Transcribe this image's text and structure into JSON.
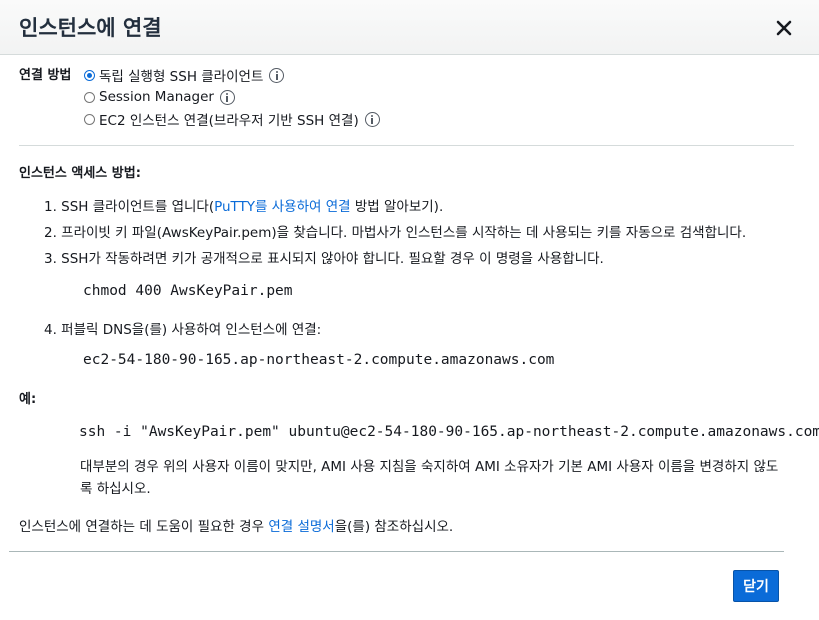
{
  "modal": {
    "title": "인스턴스에 연결"
  },
  "connection_method": {
    "label": "연결 방법",
    "options": [
      {
        "label": "독립 실행형 SSH 클라이언트",
        "selected": true
      },
      {
        "label": "Session Manager",
        "selected": false
      },
      {
        "label": "EC2 인스턴스 연결(브라우저 기반 SSH 연결)",
        "selected": false
      }
    ]
  },
  "access": {
    "title": "인스턴스 액세스 방법:",
    "step1": {
      "prefix": "1. SSH 클라이언트를 엽니다(",
      "link": "PuTTY를 사용하여 연결",
      "suffix": " 방법 알아보기)."
    },
    "step2": "2. 프라이빗 키 파일(AwsKeyPair.pem)을 찾습니다. 마법사가 인스턴스를 시작하는 데 사용되는 키를 자동으로 검색합니다.",
    "step3": "3. SSH가 작동하려면 키가 공개적으로 표시되지 않아야 합니다. 필요할 경우 이 명령을 사용합니다.",
    "chmod_cmd": "chmod 400 AwsKeyPair.pem",
    "step4": "4. 퍼블릭 DNS을(를) 사용하여 인스턴스에 연결:",
    "dns": "ec2-54-180-90-165.ap-northeast-2.compute.amazonaws.com"
  },
  "example": {
    "label": "예:",
    "command": "ssh -i \"AwsKeyPair.pem\" ubuntu@ec2-54-180-90-165.ap-northeast-2.compute.amazonaws.com",
    "note": "대부분의 경우 위의 사용자 이름이 맞지만, AMI 사용 지침을 숙지하여 AMI 소유자가 기본 AMI 사용자 이름을 변경하지 않도록 하십시오."
  },
  "help": {
    "prefix": "인스턴스에 연결하는 데 도움이 필요한 경우 ",
    "link": "연결 설명서",
    "suffix": "을(를) 참조하십시오."
  },
  "footer": {
    "close_label": "닫기"
  },
  "colors": {
    "primary_button": "#0a6bd8",
    "link": "#0a6bd8"
  }
}
